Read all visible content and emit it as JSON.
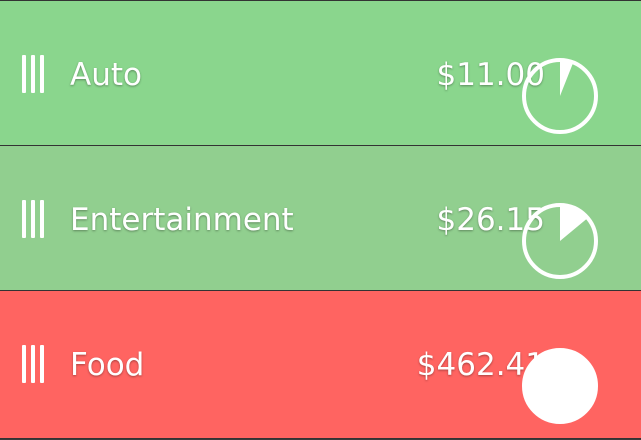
{
  "colors": {
    "auto_bg": "#8ad68d",
    "entertainment_bg": "#91cf8f",
    "food_bg": "#ff6461",
    "text": "#ffffff"
  },
  "categories": [
    {
      "label": "Auto",
      "amount": "$11.00",
      "fraction": 0.06,
      "icon": "drag-handle-icon"
    },
    {
      "label": "Entertainment",
      "amount": "$26.15",
      "fraction": 0.14,
      "icon": "drag-handle-icon"
    },
    {
      "label": "Food",
      "amount": "$462.41",
      "fraction": 1.0,
      "icon": "drag-handle-icon"
    }
  ]
}
